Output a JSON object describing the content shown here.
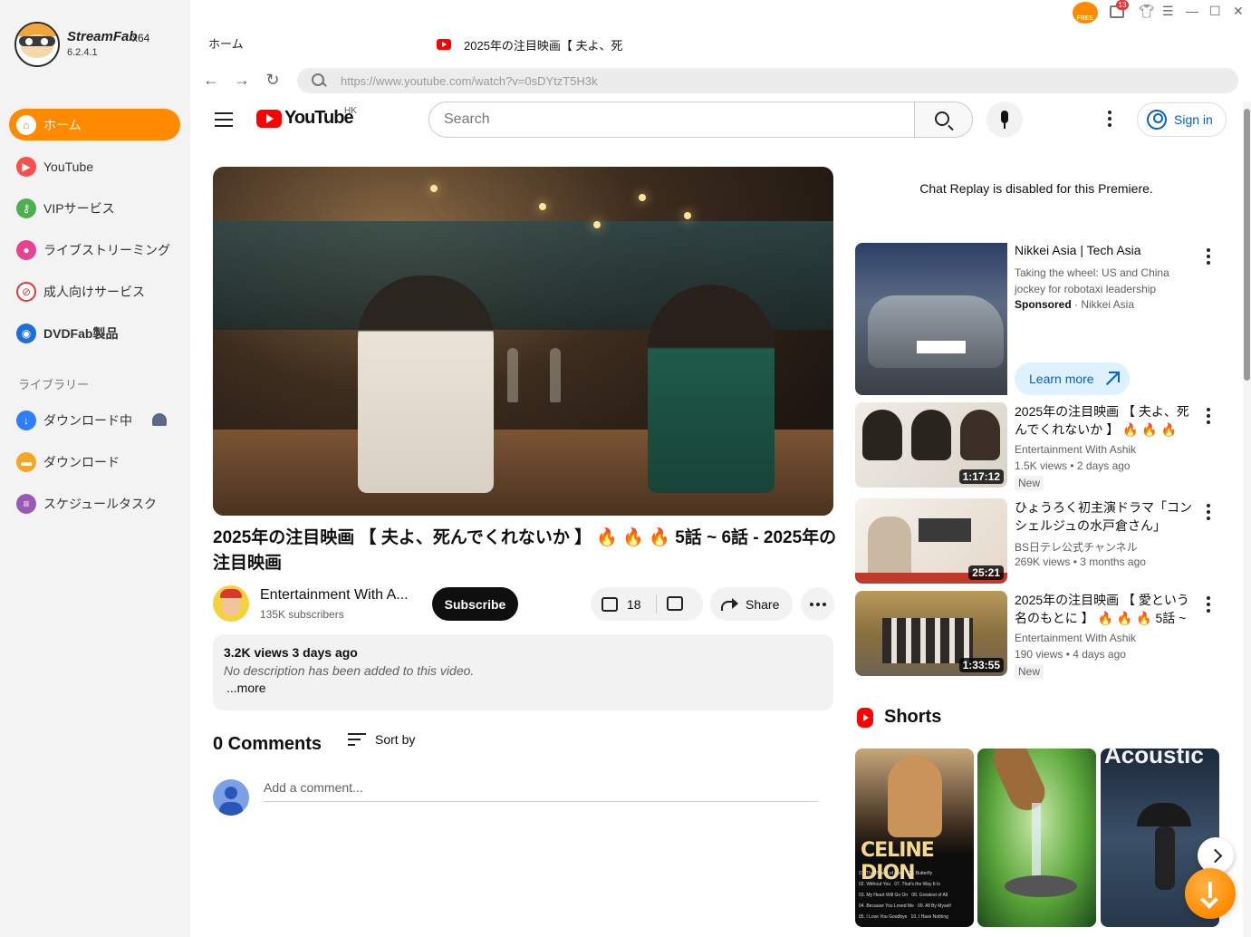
{
  "app": {
    "name": "StreamFab",
    "arch": "x64",
    "version": "6.2.4.1",
    "free_badge": "FREE",
    "gift_count": "13"
  },
  "sidebar": {
    "items": [
      {
        "label": "ホーム",
        "icon": "home-icon",
        "color": "#ff8a00"
      },
      {
        "label": "YouTube",
        "icon": "youtube-icon",
        "color": "#ff4d4d"
      },
      {
        "label": "VIPサービス",
        "icon": "key-icon",
        "color": "#4caf50"
      },
      {
        "label": "ライブストリーミング",
        "icon": "camera-icon",
        "color": "#e84393"
      },
      {
        "label": "成人向けサービス",
        "icon": "adult-block-icon",
        "color": "#e53935"
      },
      {
        "label": "DVDFab製品",
        "icon": "dvdfab-icon",
        "color": "#1e6fd9"
      }
    ],
    "library_label": "ライブラリー",
    "library": [
      {
        "label": "ダウンロード中",
        "icon": "download-arrow-icon",
        "color": "#2d7ff9"
      },
      {
        "label": "ダウンロード",
        "icon": "folder-icon",
        "color": "#f5a623"
      },
      {
        "label": "スケジュールタスク",
        "icon": "schedule-list-icon",
        "color": "#9b59b6"
      }
    ]
  },
  "tabs": {
    "home": "ホーム",
    "video": "2025年の注目映画【 夫よ、死"
  },
  "browser": {
    "url": "https://www.youtube.com/watch?v=0sDYtzT5H3k"
  },
  "youtube": {
    "logo_text": "YouTube",
    "region": "HK",
    "search_placeholder": "Search",
    "sign_in": "Sign in"
  },
  "video": {
    "title": "2025年の注目映画 【 夫よ、死んでくれないか 】 🔥 🔥 🔥 5話 ~ 6話 - 2025年の注目映画",
    "channel_name": "Entertainment With A...",
    "channel_subs": "135K subscribers",
    "subscribe": "Subscribe",
    "likes": "18",
    "share": "Share",
    "views_line": "3.2K views  3 days ago",
    "description": "No description has been added to this video.",
    "more": "...more"
  },
  "comments": {
    "count_label": "0 Comments",
    "sort_label": "Sort by",
    "placeholder": "Add a comment..."
  },
  "right": {
    "chat_replay": "Chat Replay is disabled for this Premiere.",
    "ad": {
      "title": "Nikkei Asia | Tech Asia",
      "description": "Taking the wheel: US and China jockey for robotaxi leadership",
      "sponsored": "Sponsored",
      "sponsor_name": " · Nikkei Asia",
      "cta": "Learn more"
    },
    "recommendations": [
      {
        "title": "2025年の注目映画 【 夫よ、死んでくれないか 】 🔥 🔥 🔥 7...",
        "channel": "Entertainment With Ashik",
        "meta": "1.5K views  • 2 days ago",
        "badge": "New",
        "duration": "1:17:12"
      },
      {
        "title": "ひょうろく初主演ドラマ「コンシェルジュの水戸倉さん」",
        "channel": "BS日テレ公式チャンネル",
        "meta": "269K views  • 3 months ago",
        "badge": "",
        "duration": "25:21"
      },
      {
        "title": "2025年の注目映画 【 愛という名のもとに 】 🔥 🔥 🔥 5話 ~ ...",
        "channel": "Entertainment With Ashik",
        "meta": "190 views  • 4 days ago",
        "badge": "New",
        "duration": "1:33:55"
      }
    ],
    "shorts_label": "Shorts",
    "shorts": [
      {
        "title_text": "CELINE DION"
      },
      {
        "title_text": ""
      },
      {
        "title_text": "Acoustic"
      }
    ]
  }
}
